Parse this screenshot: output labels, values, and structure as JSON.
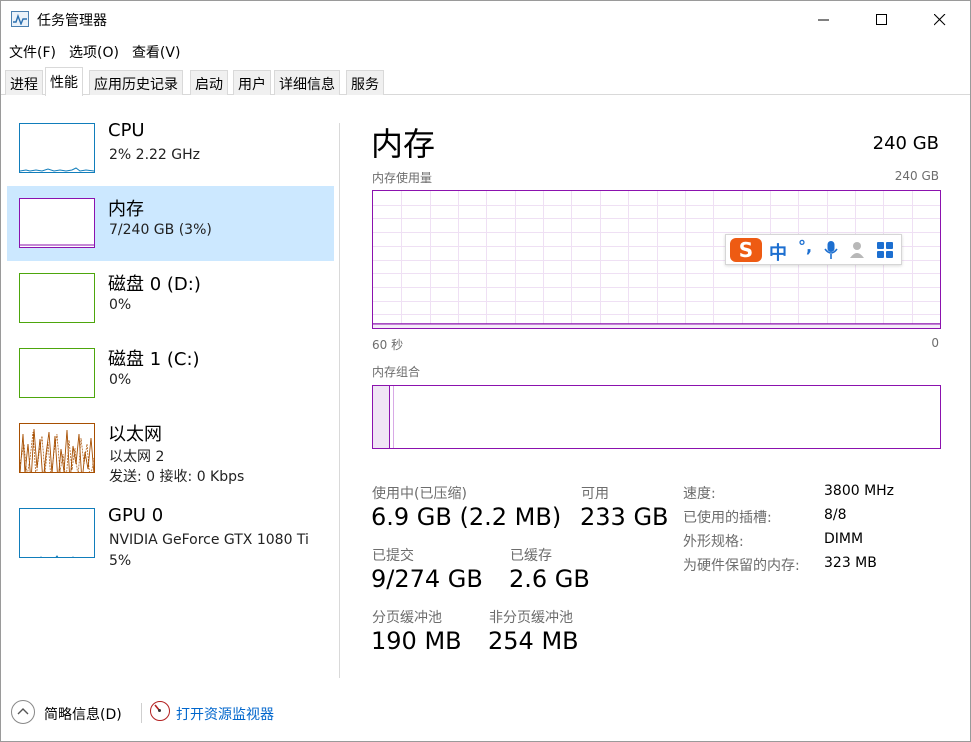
{
  "window": {
    "title": "任务管理器"
  },
  "menu": [
    "文件(F)",
    "选项(O)",
    "查看(V)"
  ],
  "tabs": [
    "进程",
    "性能",
    "应用历史记录",
    "启动",
    "用户",
    "详细信息",
    "服务"
  ],
  "active_tab": "性能",
  "sidebar": [
    {
      "title": "CPU",
      "line1": "2% 2.22 GHz",
      "line2": "",
      "color": "#117dbb"
    },
    {
      "title": "内存",
      "line1": "7/240 GB (3%)",
      "line2": "",
      "color": "#8b12ae"
    },
    {
      "title": "磁盘 0 (D:)",
      "line1": "0%",
      "line2": "",
      "color": "#4da60c"
    },
    {
      "title": "磁盘 1 (C:)",
      "line1": "0%",
      "line2": "",
      "color": "#4da60c"
    },
    {
      "title": "以太网",
      "line1": "以太网 2",
      "line2": "发送: 0 接收: 0 Kbps",
      "color": "#a74f01"
    },
    {
      "title": "GPU 0",
      "line1": "NVIDIA GeForce GTX 1080 Ti",
      "line2": "5%",
      "color": "#117dbb"
    }
  ],
  "main": {
    "title": "内存",
    "capacity": "240 GB",
    "usage_label": "内存使用量",
    "usage_max": "240 GB",
    "time_left": "60 秒",
    "time_right": "0",
    "composition_label": "内存组合",
    "usage_fraction": 0.03,
    "accent": "#8b12ae",
    "stats": {
      "in_use_label": "使用中(已压缩)",
      "in_use_value": "6.9 GB (2.2 MB)",
      "available_label": "可用",
      "available_value": "233 GB",
      "committed_label": "已提交",
      "committed_value": "9/274 GB",
      "cached_label": "已缓存",
      "cached_value": "2.6 GB",
      "paged_label": "分页缓冲池",
      "paged_value": "190 MB",
      "nonpaged_label": "非分页缓冲池",
      "nonpaged_value": "254 MB"
    },
    "props": [
      {
        "label": "速度:",
        "value": "3800 MHz"
      },
      {
        "label": "已使用的插槽:",
        "value": "8/8"
      },
      {
        "label": "外形规格:",
        "value": "DIMM"
      },
      {
        "label": "为硬件保留的内存:",
        "value": "323 MB"
      }
    ]
  },
  "ime": {
    "mode": "中",
    "punct": "°,"
  },
  "footer": {
    "summary": "简略信息(D)",
    "resource_monitor": "打开资源监视器"
  }
}
